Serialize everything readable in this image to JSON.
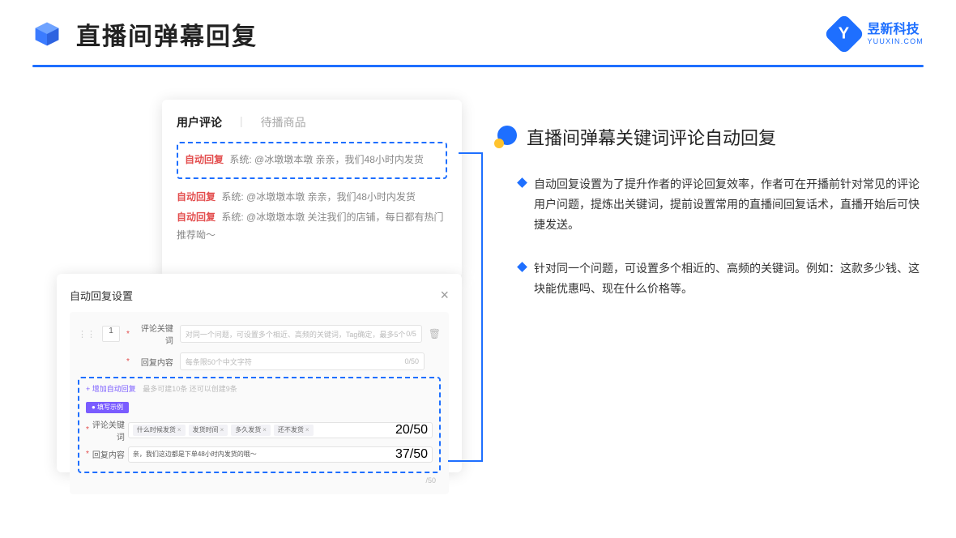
{
  "header": {
    "title": "直播间弹幕回复",
    "brand_name": "昱新科技",
    "brand_url": "YUUXIN.COM"
  },
  "card_top": {
    "tab1": "用户评论",
    "tab2": "待播商品",
    "highlight_msg": "系统: @冰墩墩本墩 亲亲，我们48小时内发货",
    "msg2": "系统: @冰墩墩本墩 亲亲，我们48小时内发货",
    "msg3": "系统: @冰墩墩本墩 关注我们的店铺，每日都有热门推荐呦～",
    "auto_reply_label": "自动回复"
  },
  "card_bottom": {
    "dialog_title": "自动回复设置",
    "idx": "1",
    "label_keyword": "评论关键词",
    "label_content": "回复内容",
    "placeholder_keyword": "对同一个问题，可设置多个相近、高频的关键词，Tag确定，最多5个",
    "placeholder_content": "每条限50个中文字符",
    "count_keyword": "0/5",
    "count_content": "0/50",
    "add_link": "+ 增加自动回复",
    "add_hint": "最多可建10条 还可以创建9条",
    "example_badge": "● 填写示例",
    "ex_tag1": "什么时候发货",
    "ex_tag2": "发货时间",
    "ex_tag3": "多久发货",
    "ex_tag4": "还不发货",
    "ex_count_kw": "20/50",
    "ex_content": "亲，我们这边都是下单48小时内发货的哦～",
    "ex_count_ct": "37/50",
    "outer_count": "/50"
  },
  "right": {
    "heading": "直播间弹幕关键词评论自动回复",
    "bullet1": "自动回复设置为了提升作者的评论回复效率，作者可在开播前针对常见的评论用户问题，提炼出关键词，提前设置常用的直播间回复话术，直播开始后可快捷发送。",
    "bullet2": "针对同一个问题，可设置多个相近的、高频的关键词。例如：这款多少钱、这块能优惠吗、现在什么价格等。"
  }
}
